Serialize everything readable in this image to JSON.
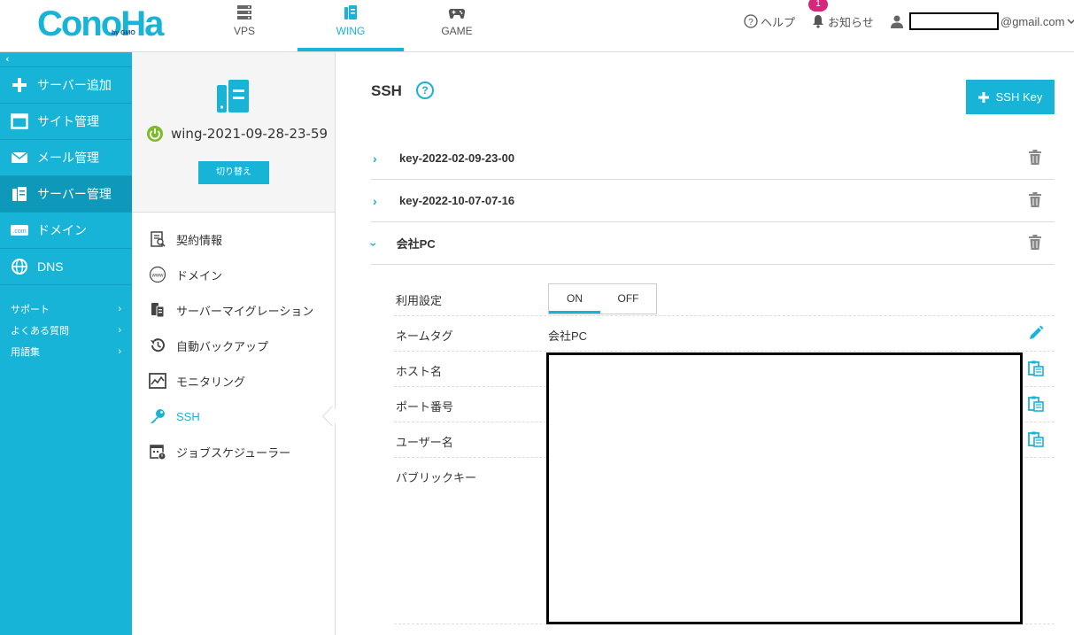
{
  "header": {
    "logo": "ConoHa",
    "logo_sub": "by GMO",
    "tabs": [
      {
        "label": "VPS"
      },
      {
        "label": "WING"
      },
      {
        "label": "GAME"
      }
    ],
    "help_label": "ヘルプ",
    "notice_label": "お知らせ",
    "notice_count": "1",
    "user_email_suffix": "@gmail.com"
  },
  "sidebar": {
    "collapse_label": "‹",
    "items": [
      {
        "label": "サーバー追加",
        "icon": "plus-icon"
      },
      {
        "label": "サイト管理",
        "icon": "window-icon"
      },
      {
        "label": "メール管理",
        "icon": "mail-icon"
      },
      {
        "label": "サーバー管理",
        "icon": "server-icon"
      },
      {
        "label": "ドメイン",
        "icon": "domain-icon"
      },
      {
        "label": "DNS",
        "icon": "globe-icon"
      }
    ],
    "support": [
      {
        "label": "サポート"
      },
      {
        "label": "よくある質問"
      },
      {
        "label": "用語集"
      }
    ]
  },
  "server_panel": {
    "server_name": "wing-2021-09-28-23-59",
    "switch_label": "切り替え",
    "menu": [
      {
        "label": "契約情報",
        "icon": "contract-icon"
      },
      {
        "label": "ドメイン",
        "icon": "www-icon"
      },
      {
        "label": "サーバーマイグレーション",
        "icon": "migration-icon"
      },
      {
        "label": "自動バックアップ",
        "icon": "backup-icon"
      },
      {
        "label": "モニタリング",
        "icon": "monitoring-icon"
      },
      {
        "label": "SSH",
        "icon": "key-icon"
      },
      {
        "label": "ジョブスケジューラー",
        "icon": "scheduler-icon"
      }
    ]
  },
  "main": {
    "title": "SSH",
    "help_glyph": "?",
    "add_key_label": "SSH Key",
    "keys": [
      {
        "name": "key-2022-02-09-23-00",
        "expanded": false
      },
      {
        "name": "key-2022-10-07-07-16",
        "expanded": false
      },
      {
        "name": "会社PC",
        "expanded": true
      }
    ],
    "details": {
      "usage_label": "利用設定",
      "toggle_on": "ON",
      "toggle_off": "OFF",
      "name_tag_label": "ネームタグ",
      "name_tag_value": "会社PC",
      "host_label": "ホスト名",
      "port_label": "ポート番号",
      "user_label": "ユーザー名",
      "public_key_label": "パブリックキー"
    }
  },
  "colors": {
    "accent": "#18b4d8",
    "sidebar_active": "#0e98b9",
    "badge": "#d6277a",
    "power": "#7cbb2a"
  }
}
